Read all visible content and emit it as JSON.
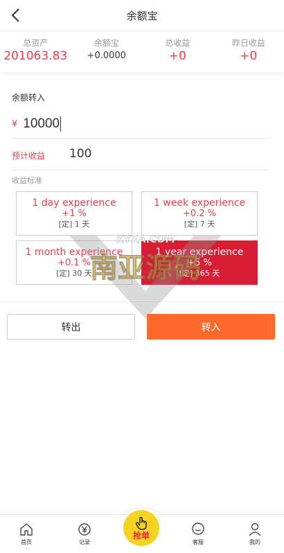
{
  "header": {
    "title": "余额宝"
  },
  "stats": [
    {
      "label": "总资产",
      "value": "201063.83"
    },
    {
      "label": "余额宝",
      "value": "+0.0000"
    },
    {
      "label": "总收益",
      "value": "+0"
    },
    {
      "label": "昨日收益",
      "value": "+0"
    }
  ],
  "transfer": {
    "section_label": "余额转入",
    "currency": "¥",
    "amount": "10000",
    "est_label": "预计收益",
    "est_value": "100",
    "standard_label": "收益标准"
  },
  "plans": [
    {
      "name": "1 day experience",
      "rate": "+1 %",
      "term": "[定] 1 天",
      "selected": false
    },
    {
      "name": "1 week experience",
      "rate": "+0.2 %",
      "term": "[定] 7 天",
      "selected": false
    },
    {
      "name": "1 month experience",
      "rate": "+0.1 %",
      "term": "[定] 30 天",
      "selected": false
    },
    {
      "name": "1 year experience",
      "rate": "+5 %",
      "term": "[定] 365 天",
      "selected": true
    }
  ],
  "actions": {
    "out_label": "转出",
    "in_label": "转入"
  },
  "watermark": {
    "text": "南亚源码",
    "sub": "KYXA.COM"
  },
  "tabbar": {
    "home": "首页",
    "records": "记录",
    "grab": "抢单",
    "service": "客服",
    "mine": "我的"
  },
  "colors": {
    "accent": "#e8404a",
    "selected_plan": "#d81e35",
    "primary_button": "#ff6a2b",
    "grab_button": "#f5d321"
  }
}
